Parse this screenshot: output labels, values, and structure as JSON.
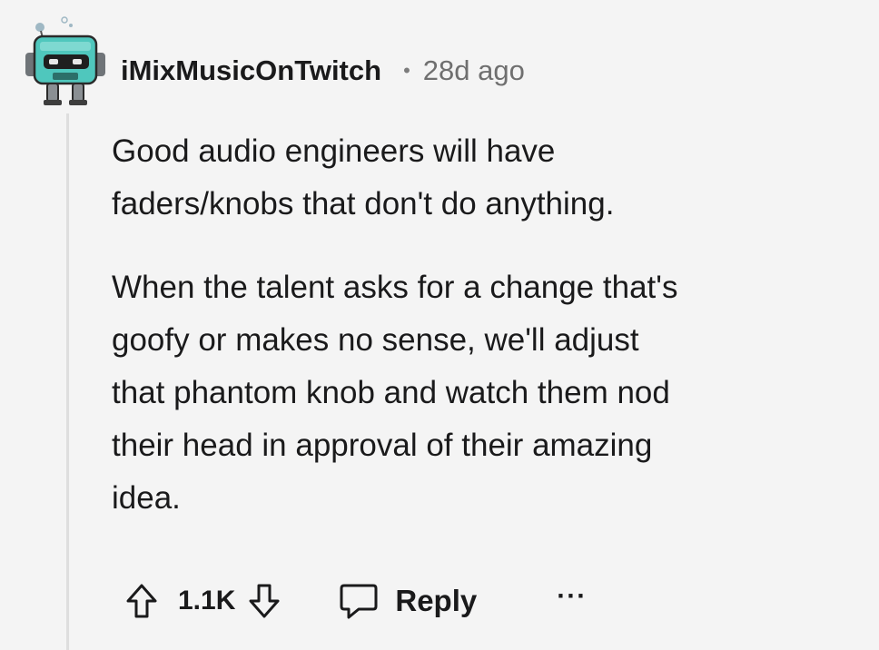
{
  "comment": {
    "author": "iMixMusicOnTwitch",
    "separator": "•",
    "age": "28d ago",
    "paragraphs": [
      "Good audio engineers will have\nfaders/knobs that don't do anything.",
      "When the talent asks for a change that's\ngoofy or makes no sense, we'll adjust\nthat phantom knob and watch them nod\ntheir head in approval of their amazing\nidea."
    ]
  },
  "actions": {
    "score": "1.1K",
    "reply_label": "Reply",
    "more_label": "···"
  },
  "icons": {
    "avatar": "robot-avatar-icon",
    "upvote": "upvote-arrow-icon",
    "downvote": "downvote-arrow-icon",
    "reply": "speech-bubble-icon",
    "more": "ellipsis-icon"
  },
  "colors": {
    "background": "#f4f4f4",
    "text": "#1a1a1b",
    "meta": "#6f6f6f",
    "thread_line": "#dedede",
    "avatar_teal": "#4fc7bd"
  }
}
